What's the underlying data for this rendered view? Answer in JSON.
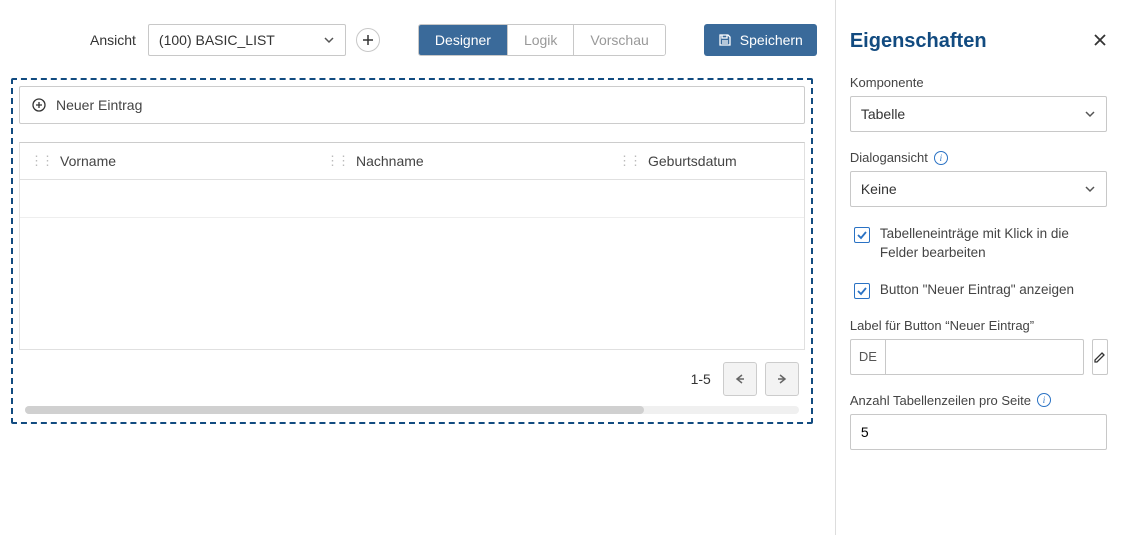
{
  "toolbar": {
    "view_label": "Ansicht",
    "view_value": "(100) BASIC_LIST",
    "tabs": {
      "designer": "Designer",
      "logik": "Logik",
      "vorschau": "Vorschau"
    },
    "save": "Speichern"
  },
  "table": {
    "new_entry": "Neuer Eintrag",
    "columns": [
      "Vorname",
      "Nachname",
      "Geburtsdatum"
    ],
    "pager": "1-5"
  },
  "panel": {
    "title": "Eigenschaften",
    "component_label": "Komponente",
    "component_value": "Tabelle",
    "dialog_label": "Dialogansicht",
    "dialog_value": "Keine",
    "cb_inline_edit": "Tabelleneinträge mit Klick in die Felder bearbeiten",
    "cb_show_new_btn": "Button \"Neuer Eintrag\" anzeigen",
    "label_for_btn": "Label für Button “Neuer Eintrag”",
    "lang_prefix": "DE",
    "rows_label": "Anzahl Tabellenzeilen pro Seite",
    "rows_value": "5"
  }
}
